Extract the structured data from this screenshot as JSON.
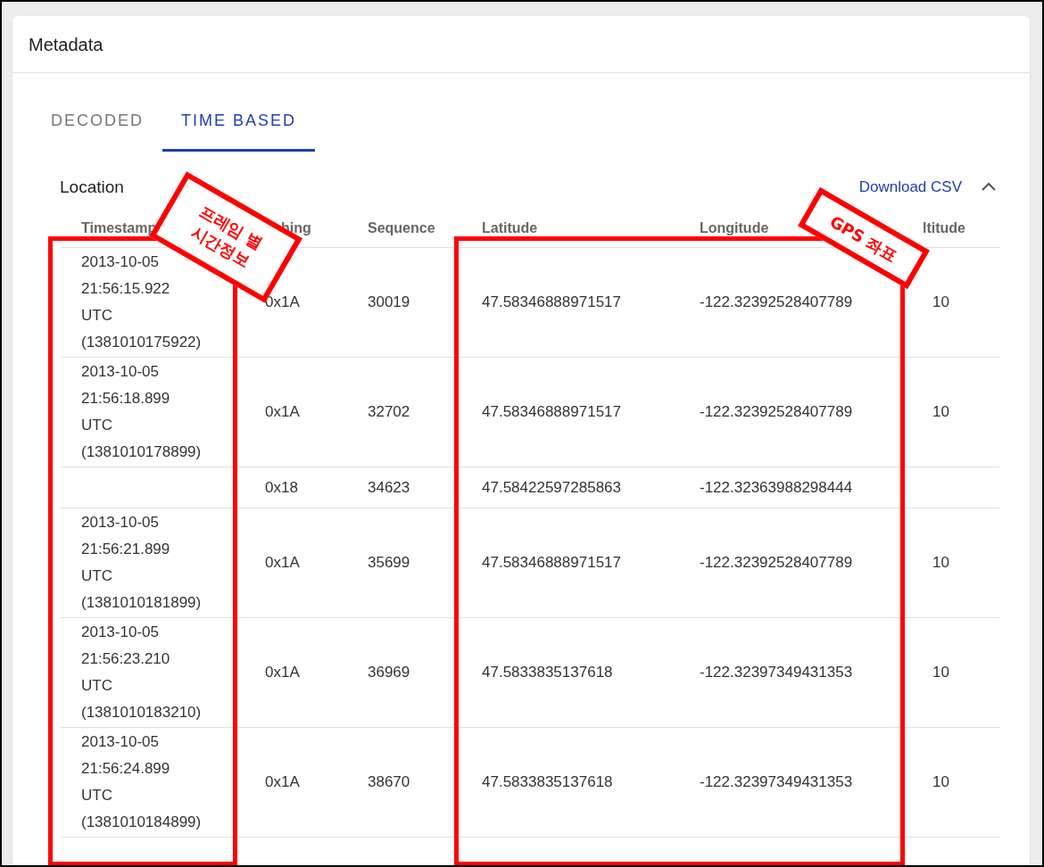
{
  "panel": {
    "title": "Metadata"
  },
  "tabs": [
    {
      "label": "DECODED",
      "selected": false
    },
    {
      "label": "TIME BASED",
      "selected": true
    }
  ],
  "section": {
    "title": "Location",
    "action": "Download CSV",
    "expanded": true
  },
  "table": {
    "columns": [
      "Timestamp",
      "hing",
      "Sequence",
      "Latitude",
      "Longitude",
      "ltitude"
    ],
    "rows": [
      [
        "2013-10-05 21:56:15.922 UTC (1381010175922)",
        "0x1A",
        "30019",
        "47.58346888971517",
        "-122.32392528407789",
        "10"
      ],
      [
        "2013-10-05 21:56:18.899 UTC (1381010178899)",
        "0x1A",
        "32702",
        "47.58346888971517",
        "-122.32392528407789",
        "10"
      ],
      [
        null,
        "0x18",
        "34623",
        "47.58422597285863",
        "-122.32363988298444",
        null
      ],
      [
        "2013-10-05 21:56:21.899 UTC (1381010181899)",
        "0x1A",
        "35699",
        "47.58346888971517",
        "-122.32392528407789",
        "10"
      ],
      [
        "2013-10-05 21:56:23.210 UTC (1381010183210)",
        "0x1A",
        "36969",
        "47.5833835137618",
        "-122.32397349431353",
        "10"
      ],
      [
        "2013-10-05 21:56:24.899 UTC (1381010184899)",
        "0x1A",
        "38670",
        "47.5833835137618",
        "-122.32397349431353",
        "10"
      ]
    ]
  },
  "annotations": [
    {
      "label": "프레임 별\n시간정보"
    },
    {
      "label": "GPS 좌표"
    }
  ]
}
